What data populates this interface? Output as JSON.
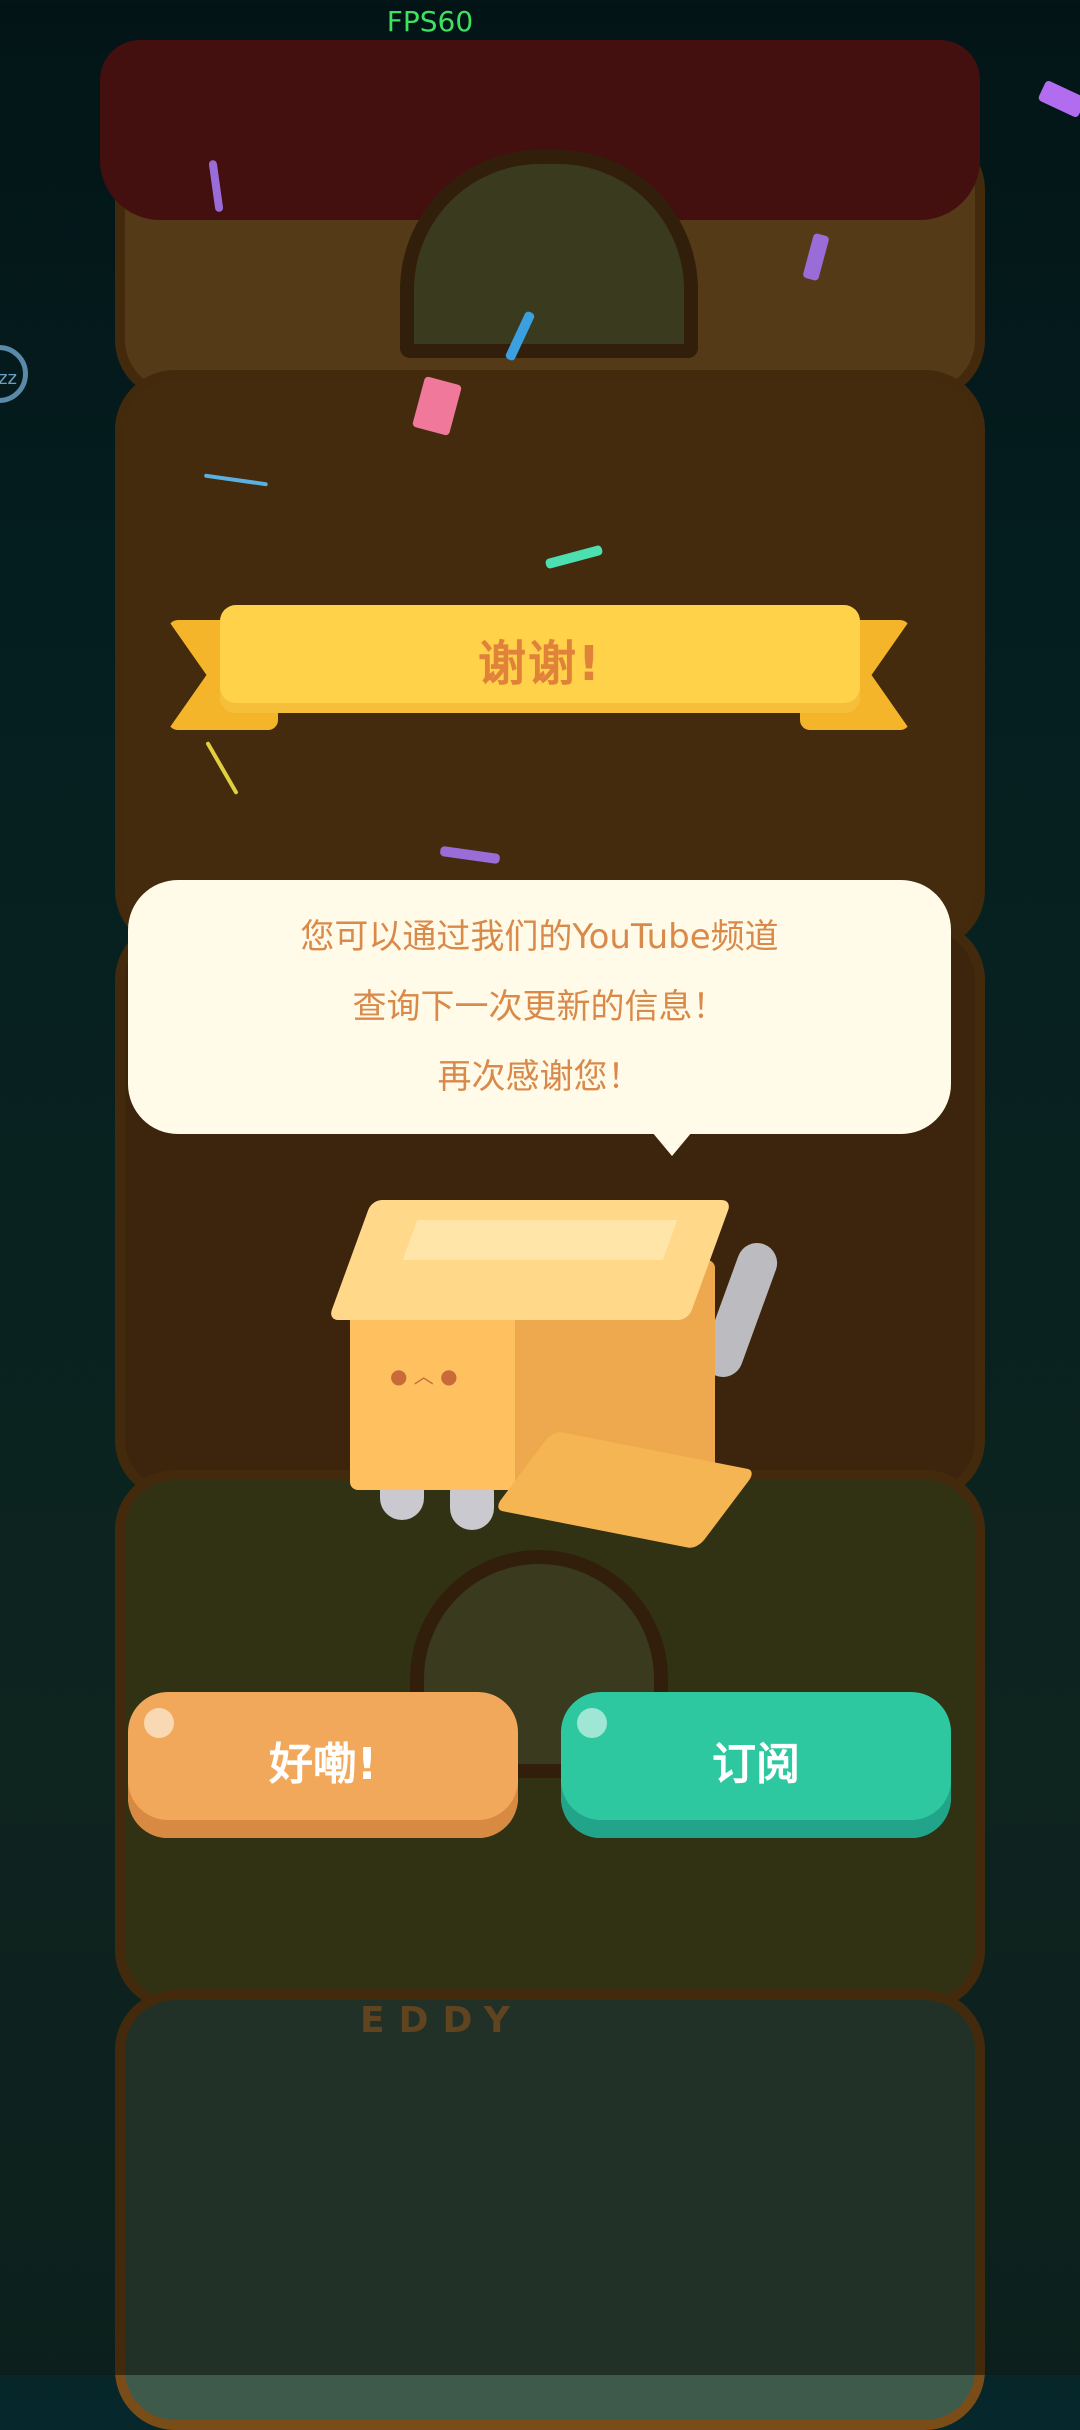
{
  "hud": {
    "fps": "FPS60",
    "side_badge": "zz"
  },
  "background": {
    "sign_text": "EDDY"
  },
  "dialog": {
    "title": "谢谢!",
    "message_lines": [
      "您可以通过我们的YouTube频道",
      "查询下一次更新的信息！",
      "再次感谢您！"
    ],
    "ok_button": "好嘞!",
    "subscribe_button": "订阅"
  },
  "colors": {
    "ribbon": "#ffd24a",
    "title_text": "#e0823a",
    "bubble_bg": "#fffbe8",
    "bubble_text": "#d98a4a",
    "ok_button": "#f2a85a",
    "subscribe_button": "#2ec8a0"
  }
}
